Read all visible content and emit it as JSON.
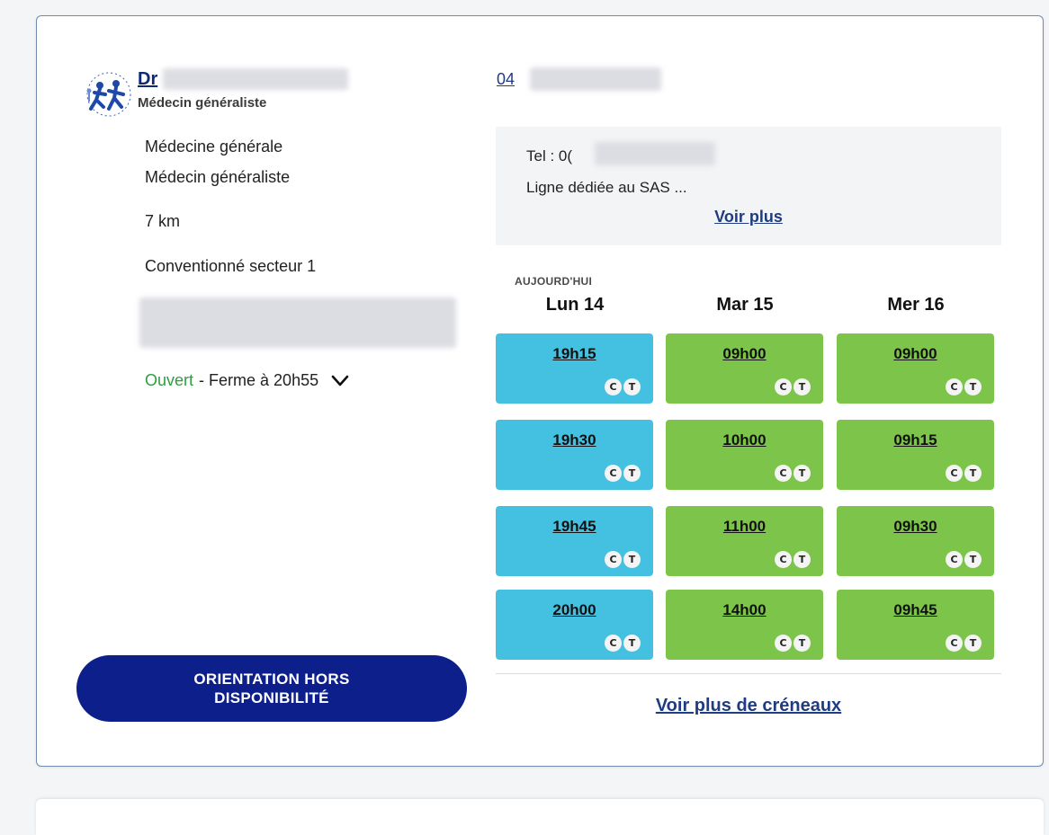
{
  "doctor": {
    "title_prefix": "Dr",
    "specialty_sub": "Médecin généraliste",
    "discipline": "Médecine générale",
    "profession": "Médecin généraliste",
    "distance": "7 km",
    "convention": "Conventionné secteur 1",
    "status_open": "Ouvert",
    "status_close": " - Ferme à 20h55"
  },
  "contact": {
    "phone_prefix": "04",
    "note_tel_prefix": "Tel : 0(",
    "note_text": "Ligne dédiée au SAS ...",
    "voir_plus": "Voir plus"
  },
  "schedule": {
    "today_label": "AUJOURD'HUI",
    "days": [
      "Lun 14",
      "Mar 15",
      "Mer 16"
    ],
    "slots": [
      [
        "19h15",
        "19h30",
        "19h45",
        "20h00"
      ],
      [
        "09h00",
        "10h00",
        "11h00",
        "14h00"
      ],
      [
        "09h00",
        "09h15",
        "09h30",
        "09h45"
      ]
    ],
    "badge_c": "C",
    "badge_t": "T",
    "colors": {
      "today": "#44c0e1",
      "other": "#7dc44a"
    },
    "more_label": "Voir plus de créneaux"
  },
  "orientation_button": "ORIENTATION HORS DISPONIBILITÉ"
}
